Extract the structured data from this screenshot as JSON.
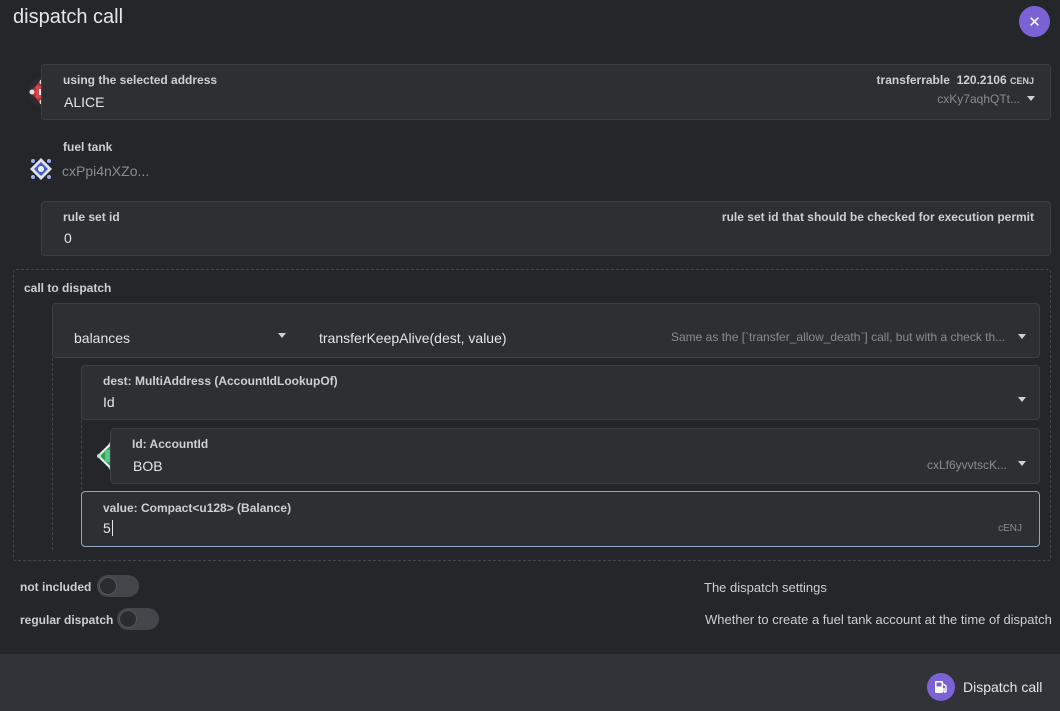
{
  "header": {
    "title": "dispatch call"
  },
  "account": {
    "label": "using the selected address",
    "name": "ALICE",
    "transferrable_label": "transferrable",
    "transferrable_value": "120.2106",
    "transferrable_unit": "CENJ",
    "address": "cxKy7aqhQTt..."
  },
  "fuel_tank": {
    "label": "fuel tank",
    "address": "cxPpi4nXZo..."
  },
  "rule_set": {
    "label": "rule set id",
    "hint": "rule set id that should be checked for execution permit",
    "value": "0"
  },
  "call": {
    "label": "call to dispatch",
    "section": "balances",
    "method": "transferKeepAlive(dest, value)",
    "description": "Same as the [`transfer_allow_death`] call, but with a check th...",
    "dest": {
      "label": "dest: MultiAddress (AccountIdLookupOf)",
      "value": "Id"
    },
    "id": {
      "label": "Id: AccountId",
      "name": "BOB",
      "address": "cxLf6yvvtscK..."
    },
    "amount": {
      "label": "value: Compact<u128> (Balance)",
      "value": "5",
      "unit": "cENJ"
    }
  },
  "settings": {
    "not_included_label": "not included",
    "not_included_hint": "The dispatch settings",
    "regular_dispatch_label": "regular dispatch",
    "regular_dispatch_hint": "Whether to create a fuel tank account at the time of dispatch"
  },
  "footer": {
    "dispatch_label": "Dispatch call"
  },
  "colors": {
    "accent": "#7b63d6",
    "background": "#25262a",
    "panel": "#2e2f33"
  }
}
